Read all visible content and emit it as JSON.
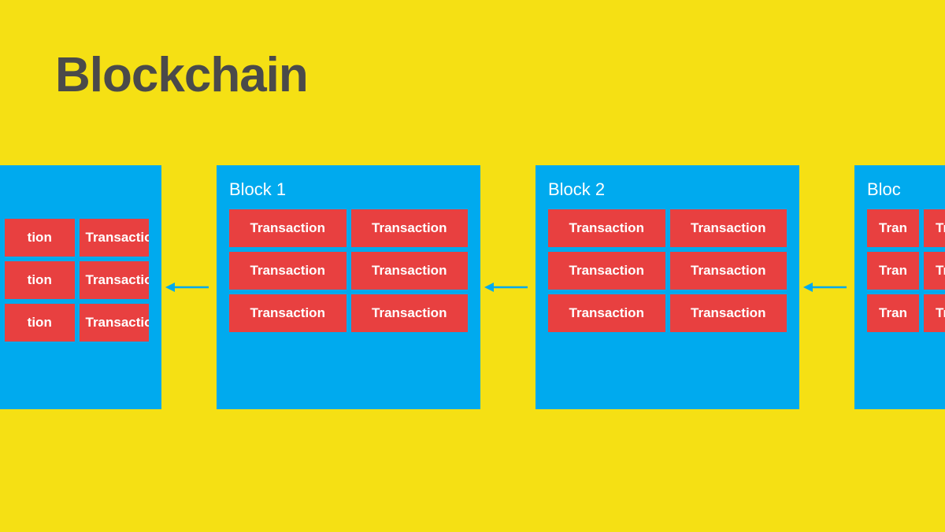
{
  "title": "Blockchain",
  "colors": {
    "background": "#F5E014",
    "block": "#00AAEE",
    "transaction": "#E84040",
    "text_light": "#ffffff",
    "text_dark": "#4a4a4a",
    "arrow": "#00AAEE"
  },
  "blocks": [
    {
      "id": "block-prev",
      "label": "",
      "partial": "left",
      "transactions": [
        "tion",
        "Transaction",
        "tion",
        "Transaction",
        "tion",
        "Transaction"
      ]
    },
    {
      "id": "block-1",
      "label": "Block 1",
      "partial": "full",
      "transactions": [
        "Transaction",
        "Transaction",
        "Transaction",
        "Transaction",
        "Transaction",
        "Transaction"
      ]
    },
    {
      "id": "block-2",
      "label": "Block 2",
      "partial": "full",
      "transactions": [
        "Transaction",
        "Transaction",
        "Transaction",
        "Transaction",
        "Transaction",
        "Transaction"
      ]
    },
    {
      "id": "block-3",
      "label": "Bloc",
      "partial": "right",
      "transactions": [
        "Tran",
        "Tran",
        "Tran",
        "Tran",
        "Tran",
        "Tran"
      ]
    }
  ],
  "arrows": [
    {
      "direction": "left"
    },
    {
      "direction": "left"
    }
  ]
}
